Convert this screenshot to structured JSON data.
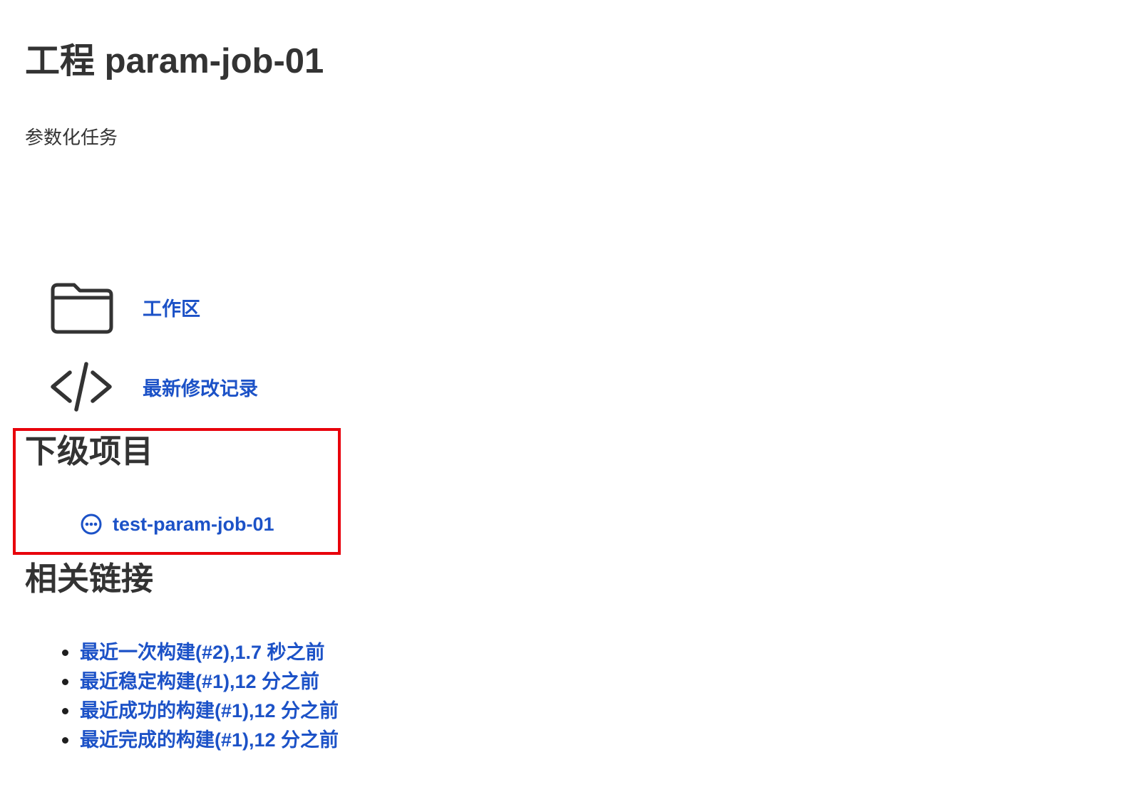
{
  "page": {
    "title": "工程 param-job-01",
    "description": "参数化任务"
  },
  "actions": [
    {
      "label": "工作区",
      "icon": "folder-icon"
    },
    {
      "label": "最新修改记录",
      "icon": "code-icon"
    }
  ],
  "subprojects": {
    "heading": "下级项目",
    "items": [
      {
        "label": "test-param-job-01",
        "icon": "status-pending-icon"
      }
    ]
  },
  "related_links": {
    "heading": "相关链接",
    "items": [
      {
        "label": "最近一次构建(#2),1.7 秒之前"
      },
      {
        "label": "最近稳定构建(#1),12 分之前"
      },
      {
        "label": "最近成功的构建(#1),12 分之前"
      },
      {
        "label": "最近完成的构建(#1),12 分之前"
      }
    ]
  },
  "colors": {
    "link": "#1c52c7",
    "text": "#333333",
    "highlight_border": "#e8000b",
    "background": "#ffffff"
  }
}
